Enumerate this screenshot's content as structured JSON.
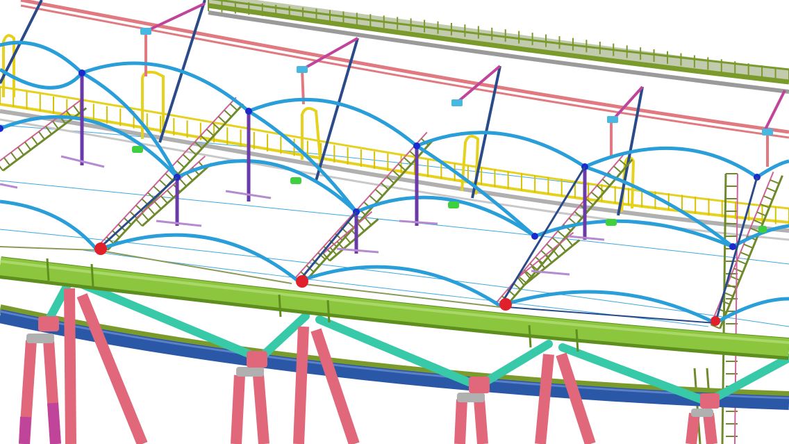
{
  "image": {
    "kind": "3D structural steel model render",
    "colors": {
      "background": "#ffffff",
      "top_walkway": "#7a9a2c",
      "top_walkway_dark": "#4f6a17",
      "red_beam": "#e07a80",
      "yellow_walkway": "#e6d21e",
      "yellow_dark": "#a89400",
      "cyan_arch": "#2a9ed8",
      "ladder_green": "#6f8a2a",
      "ladder_pink": "#d0629a",
      "purple_post": "#6a3aa8",
      "navy_brace": "#2a4a8a",
      "green_pipe": "#8cc63f",
      "green_pipe_dark": "#5e8f1e",
      "blue_pipe": "#2b57a7",
      "teal_brace": "#38c9a8",
      "pink_column": "#e0687a",
      "magenta": "#c0449a",
      "node_red": "#e0202a",
      "node_green": "#3fcf3f"
    }
  }
}
